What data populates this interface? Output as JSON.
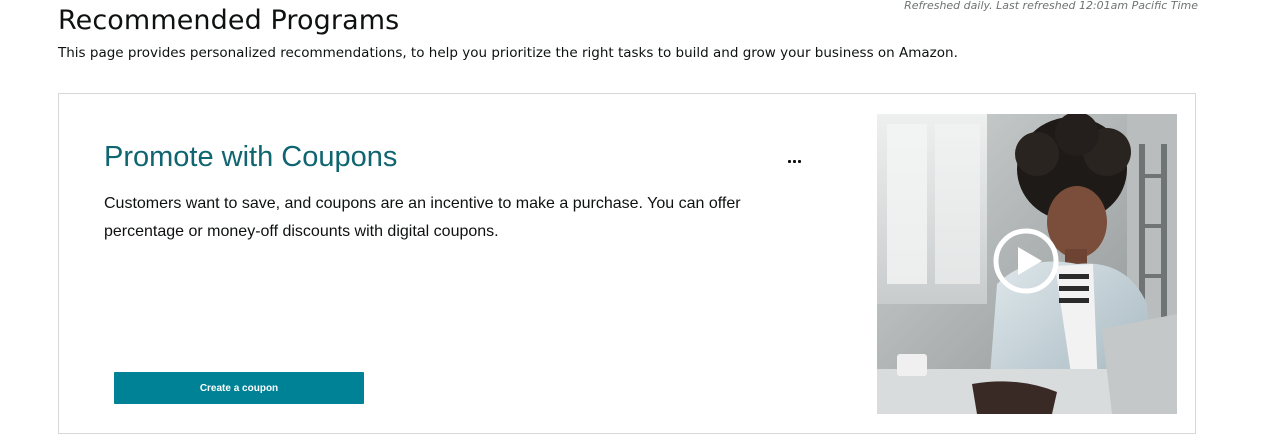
{
  "header": {
    "title": "Recommended Programs",
    "refresh_note": "Refreshed daily. Last refreshed 12:01am Pacific Time",
    "description": "This page provides personalized recommendations, to help you prioritize the right tasks to build and grow your business on Amazon."
  },
  "card": {
    "title": "Promote with Coupons",
    "body": "Customers want to save, and coupons are an incentive to make a purchase. You can offer percentage or money-off discounts with digital coupons.",
    "cta_label": "Create a coupon",
    "more_icon": "ellipsis-icon",
    "video_icon": "play-icon",
    "colors": {
      "title": "#0f6570",
      "button": "#008296"
    }
  }
}
